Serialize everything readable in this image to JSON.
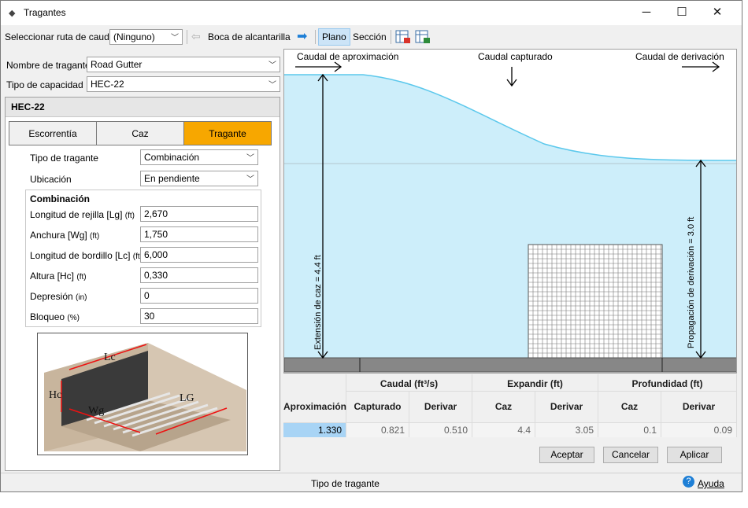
{
  "window": {
    "title": "Tragantes",
    "minimize": "─",
    "maximize": "☐",
    "close": "✕"
  },
  "toolbar": {
    "route_label": "Seleccionar ruta de caudal",
    "route_value": "(Ninguno)",
    "back_label": "Boca de alcantarilla",
    "plan_label": "Plano",
    "section_label": "Sección"
  },
  "inlet": {
    "name_label": "Nombre de tragante",
    "name_value": "Road Gutter",
    "capacity_label": "Tipo de capacidad",
    "capacity_value": "HEC-22"
  },
  "panel": {
    "heading": "HEC-22",
    "tabs": [
      "Escorrentía",
      "Caz",
      "Tragante"
    ],
    "type_label": "Tipo de tragante",
    "type_value": "Combinación",
    "location_label": "Ubicación",
    "location_value": "En pendiente",
    "group_title": "Combinación",
    "fields": [
      {
        "label": "Longitud de rejilla [Lg]",
        "unit": "(ft)",
        "value": "2,670"
      },
      {
        "label": "Anchura [Wg]",
        "unit": "(ft)",
        "value": "1,750"
      },
      {
        "label": "Longitud de bordillo [Lc]",
        "unit": "(ft)",
        "value": "6,000"
      },
      {
        "label": "Altura [Hc]",
        "unit": "(ft)",
        "value": "0,330"
      },
      {
        "label": "Depresión",
        "unit": "(in)",
        "value": "0"
      },
      {
        "label": "Bloqueo",
        "unit": "(%)",
        "value": "30"
      }
    ],
    "diagram_labels": {
      "lc": "Lc",
      "hc": "Hc",
      "wg": "Wg",
      "lg": "LG"
    }
  },
  "plot": {
    "approach": "Caudal de aproximación",
    "captured": "Caudal capturado",
    "bypass": "Caudal de derivación",
    "spread_label": "Extensión de caz  = 4.4 ft",
    "bypass_spread_label": "Propagación de derivación = 3.0 ft"
  },
  "grid": {
    "caudal": "Caudal (ft³/s)",
    "expandir": "Expandir (ft)",
    "profundidad": "Profundidad (ft)",
    "cols": [
      "Aproximación",
      "Capturado",
      "Derivar",
      "Caz",
      "Derivar",
      "Caz",
      "Derivar"
    ],
    "values": [
      "1.330",
      "0.821",
      "0.510",
      "4.4",
      "3.05",
      "0.1",
      "0.09"
    ]
  },
  "buttons": {
    "ok": "Aceptar",
    "cancel": "Cancelar",
    "apply": "Aplicar"
  },
  "status": {
    "text": "Tipo de tragante",
    "help": "Ayuda"
  },
  "colors": {
    "water": "#cdeefa",
    "water_line": "#5bc8ec",
    "selected_tab": "#f7a700",
    "selected_cell": "#a8d4f5",
    "accent_blue": "#1e7fd6"
  }
}
